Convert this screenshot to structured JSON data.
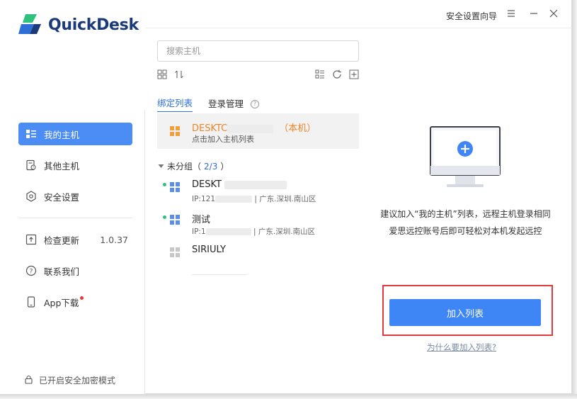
{
  "app": {
    "name": "QuickDesk",
    "guide_label": "安全设置向导"
  },
  "colors": {
    "accent": "#4b8cf5",
    "local_host": "#e8862a",
    "online": "#2ec27e",
    "highlight_border": "#e0393e"
  },
  "sidebar": {
    "items": [
      {
        "label": "我的主机",
        "icon": "host-list-icon",
        "active": true
      },
      {
        "label": "其他主机",
        "icon": "other-host-icon",
        "active": false
      },
      {
        "label": "安全设置",
        "icon": "shield-gear-icon",
        "active": false
      }
    ],
    "items2": [
      {
        "label": "检查更新",
        "icon": "upload-icon",
        "value": "1.0.37"
      },
      {
        "label": "联系我们",
        "icon": "help-circle-icon"
      },
      {
        "label": "App下载",
        "icon": "phone-icon",
        "badge": true
      }
    ],
    "footer": "已开启安全加密模式"
  },
  "search": {
    "placeholder": "搜索主机"
  },
  "tabs": [
    {
      "label": "绑定列表",
      "active": true
    },
    {
      "label": "登录管理",
      "active": false
    }
  ],
  "local_host": {
    "name": "DESKTC",
    "tag": "（本机）",
    "subtitle": "点击加入主机列表"
  },
  "group": {
    "label": "未分组（",
    "count": "2/3",
    "close": "）"
  },
  "hosts": [
    {
      "name": "DESKT",
      "ip_prefix": "IP:121",
      "location": "| 广东.深圳.南山区",
      "online": true
    },
    {
      "name": "测试",
      "ip_prefix": "IP:1",
      "location": "| 广东.深圳.南山区",
      "online": true
    },
    {
      "name": "SIRIULY",
      "online": false
    }
  ],
  "promo": {
    "line1": "建议加入“我的主机”列表，远程主机登录相同",
    "line2": "爱思远控账号后即可轻松对本机发起远控"
  },
  "add_button": "加入列表",
  "why_link": "为什么要加入列表?"
}
